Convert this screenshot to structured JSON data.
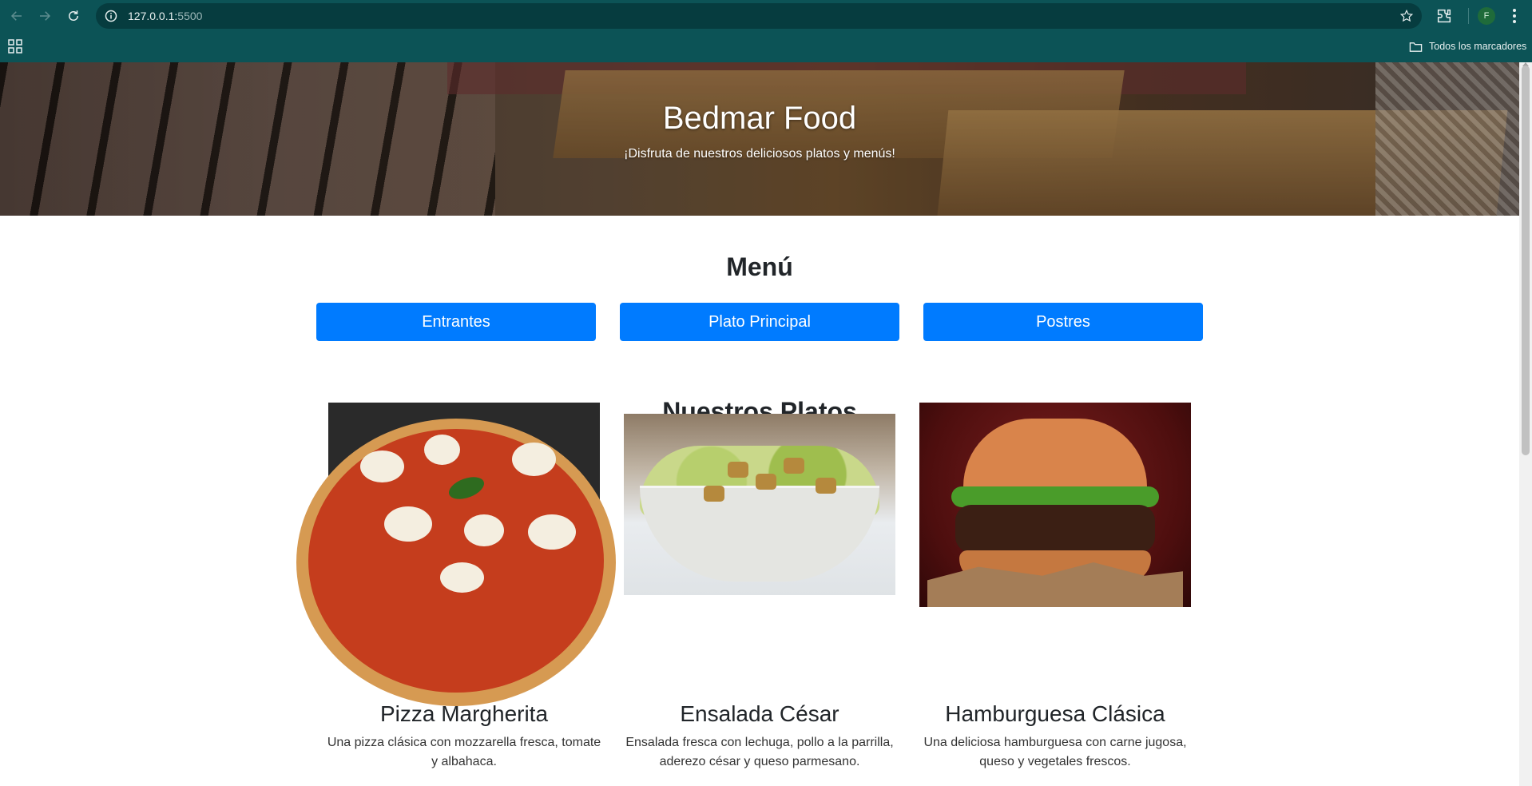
{
  "browser": {
    "url_host": "127.0.0.1:",
    "url_port": "5500",
    "bookmarks_label": "Todos los marcadores",
    "profile_initial": "F"
  },
  "hero": {
    "title": "Bedmar Food",
    "subtitle": "¡Disfruta de nuestros deliciosos platos y menús!"
  },
  "menu": {
    "title": "Menú",
    "buttons": [
      "Entrantes",
      "Plato Principal",
      "Postres"
    ]
  },
  "dishes": {
    "title": "Nuestros Platos",
    "items": [
      {
        "name": "Pizza Margherita",
        "description": "Una pizza clásica con mozzarella fresca, tomate y albahaca."
      },
      {
        "name": "Ensalada César",
        "description": "Ensalada fresca con lechuga, pollo a la parrilla, aderezo césar y queso parmesano."
      },
      {
        "name": "Hamburguesa Clásica",
        "description": "Una deliciosa hamburguesa con carne jugosa, queso y vegetales frescos."
      }
    ]
  },
  "colors": {
    "chrome": "#0c5356",
    "omnibox": "#063c3f",
    "primary_button": "#007bff",
    "heading_text": "#212529"
  },
  "icons": [
    "back-icon",
    "forward-icon",
    "reload-icon",
    "site-info-icon",
    "star-icon",
    "extensions-icon",
    "kebab-menu-icon",
    "apps-icon",
    "folder-icon"
  ]
}
